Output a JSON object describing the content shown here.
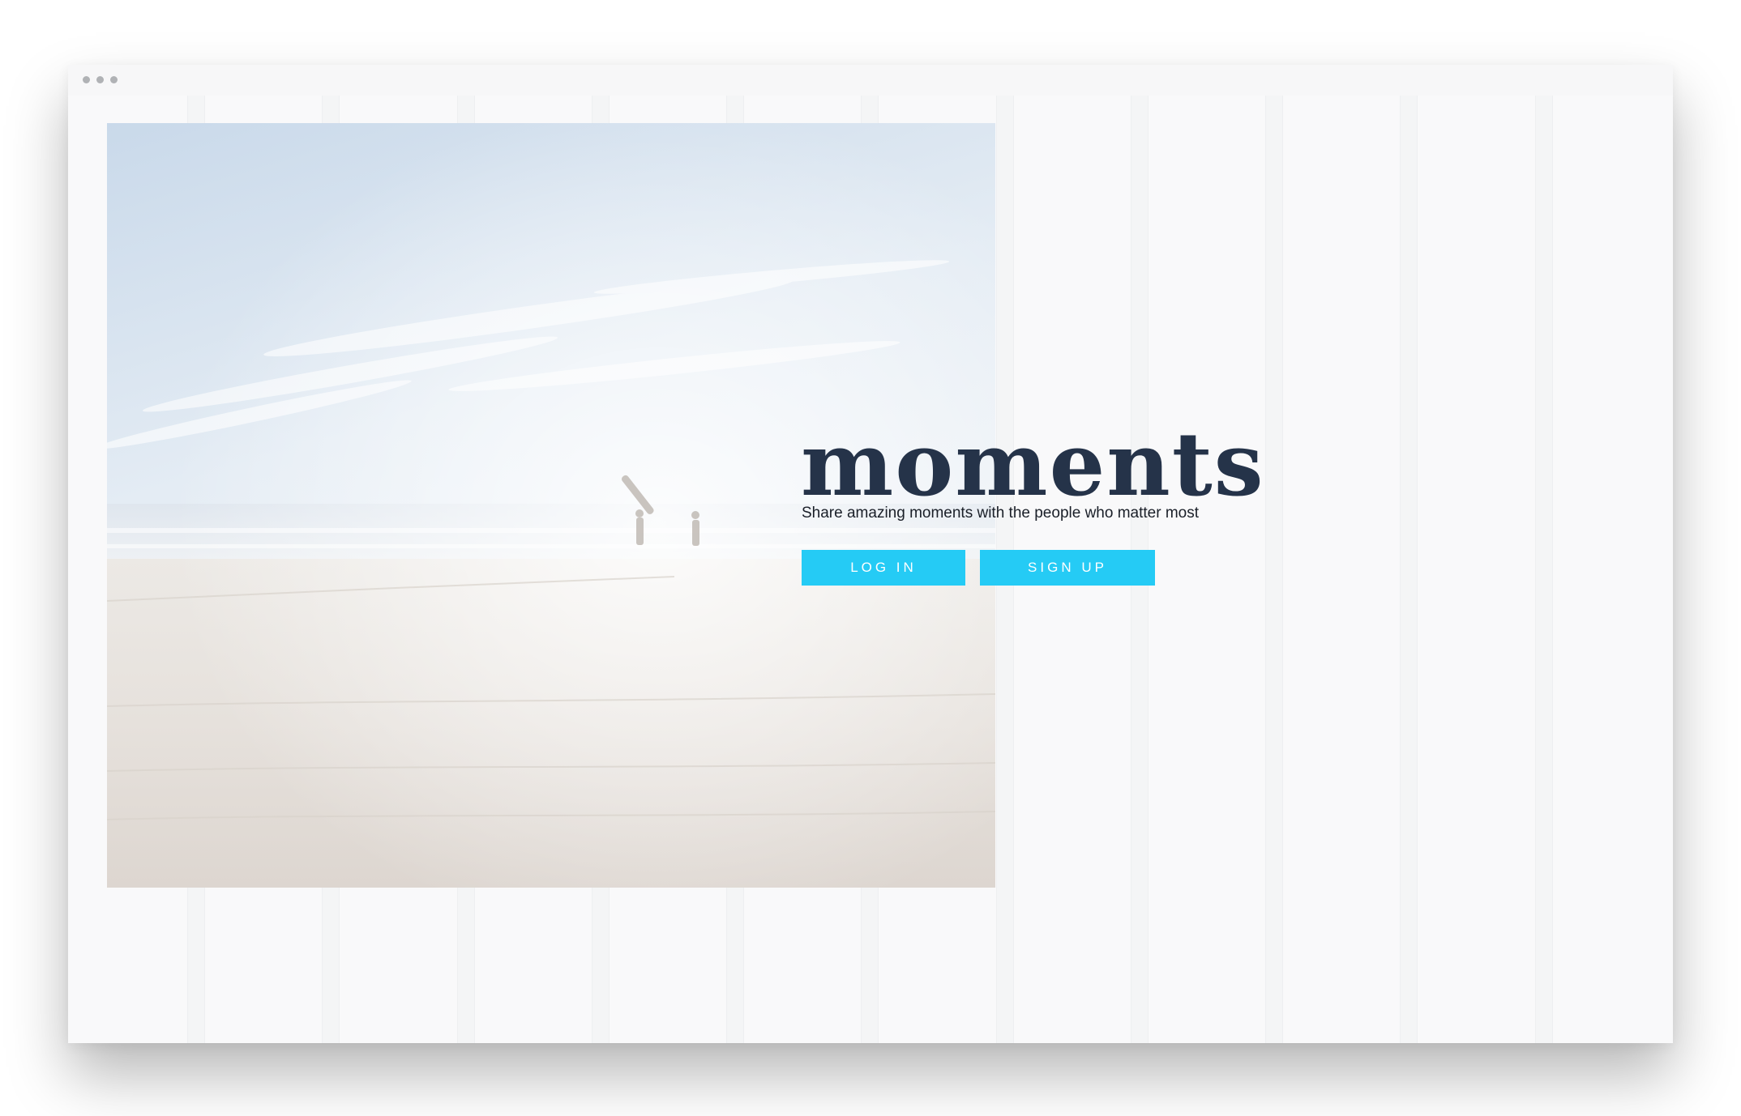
{
  "app": {
    "brand": "moments",
    "tagline": "Share amazing moments with the people who matter most"
  },
  "actions": {
    "login_label": "LOG IN",
    "signup_label": "SIGN UP"
  },
  "colors": {
    "accent": "#25cbf5",
    "brand_text": "#253349",
    "background": "#f9f9fa"
  },
  "hero": {
    "image_subject": "beach-with-surfers-photo"
  },
  "window": {
    "controls_icon": "more-dots-icon"
  }
}
